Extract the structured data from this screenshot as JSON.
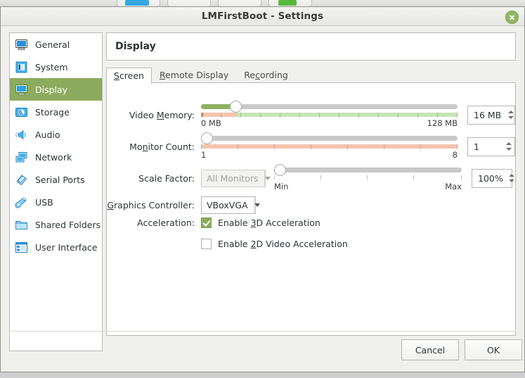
{
  "window": {
    "title": "LMFirstBoot - Settings",
    "close_icon": "close-icon"
  },
  "sidebar": {
    "items": [
      {
        "label": "General",
        "icon": "monitor-icon",
        "selected": false
      },
      {
        "label": "System",
        "icon": "chip-icon",
        "selected": false
      },
      {
        "label": "Display",
        "icon": "display-icon",
        "selected": true
      },
      {
        "label": "Storage",
        "icon": "harddisk-icon",
        "selected": false
      },
      {
        "label": "Audio",
        "icon": "speaker-icon",
        "selected": false
      },
      {
        "label": "Network",
        "icon": "network-cards-icon",
        "selected": false
      },
      {
        "label": "Serial Ports",
        "icon": "serial-port-icon",
        "selected": false
      },
      {
        "label": "USB",
        "icon": "usb-icon",
        "selected": false
      },
      {
        "label": "Shared Folders",
        "icon": "folder-icon",
        "selected": false
      },
      {
        "label": "User Interface",
        "icon": "user-interface-icon",
        "selected": false
      }
    ]
  },
  "panel": {
    "title": "Display",
    "tabs": [
      {
        "label": "Screen",
        "mnemonic": "S",
        "active": true
      },
      {
        "label": "Remote Display",
        "mnemonic": "R",
        "active": false
      },
      {
        "label": "Recording",
        "mnemonic": "c",
        "active": false
      }
    ]
  },
  "form": {
    "video_memory": {
      "label_pre": "Video ",
      "label_mn": "M",
      "label_post": "emory:",
      "value": "16 MB",
      "min_label": "0 MB",
      "max_label": "128 MB",
      "percent": 13,
      "warn_percent": 14,
      "ticks": 13
    },
    "monitor_count": {
      "label_pre": "Mo",
      "label_mn": "n",
      "label_post": "itor Count:",
      "value": "1",
      "min_label": "1",
      "max_label": "8",
      "percent": 0,
      "warn_percent": 100,
      "ticks": 6
    },
    "scale_factor": {
      "label": "Scale Factor:",
      "monitor_select": "All Monitors",
      "monitor_select_disabled": true,
      "value": "100%",
      "min_label": "Min",
      "max_label": "Max",
      "percent": 0,
      "ticks": 5
    },
    "graphics_controller": {
      "label_pre": "",
      "label_mn": "G",
      "label_post": "raphics Controller:",
      "value": "VBoxVGA"
    },
    "acceleration": {
      "label": "Acceleration:",
      "options": [
        {
          "pre": "Enable ",
          "mn": "3",
          "post": "D Acceleration",
          "checked": true
        },
        {
          "pre": "Enable ",
          "mn": "2",
          "post": "D Video Acceleration",
          "checked": false
        }
      ]
    }
  },
  "footer": {
    "cancel_label": "Cancel",
    "ok_label": "OK"
  },
  "colors": {
    "selection": "#8cab5e",
    "slider_fill": "#8faf62",
    "warn_segment": "#f6c4ad",
    "ok_segment": "#c3e6b4",
    "accent_blue": "#2a8fd8"
  }
}
